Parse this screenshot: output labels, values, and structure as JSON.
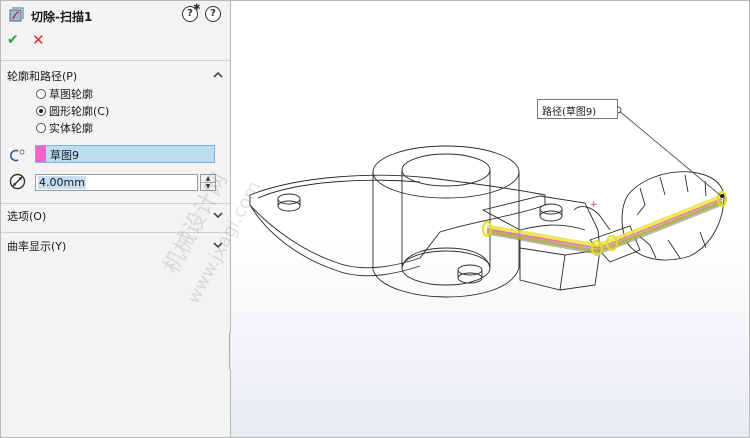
{
  "property_manager": {
    "title": "切除-扫描1",
    "help_label": "?",
    "ok_label": "✔",
    "cancel_label": "✕",
    "profile_path_section": {
      "label": "轮廓和路径(P)",
      "options": [
        {
          "label": "草图轮廓",
          "selected": false
        },
        {
          "label": "圆形轮廓(C)",
          "selected": true
        },
        {
          "label": "实体轮廓",
          "selected": false
        }
      ],
      "path_selection": "草图9",
      "diameter_value": "4.00mm"
    },
    "options_section": {
      "label": "选项(O)"
    },
    "curvature_section": {
      "label": "曲率显示(Y)"
    }
  },
  "viewport": {
    "callout_label": "路径(草图9)",
    "watermark_line1": "机械设计网",
    "watermark_line2": "www.jxagi.com"
  },
  "colors": {
    "ok": "#2ea043",
    "cancel": "#d63030",
    "path_highlight": "#e9e43a",
    "sweep_path": "#ee66c9",
    "selection_field": "#bcdcf2"
  }
}
